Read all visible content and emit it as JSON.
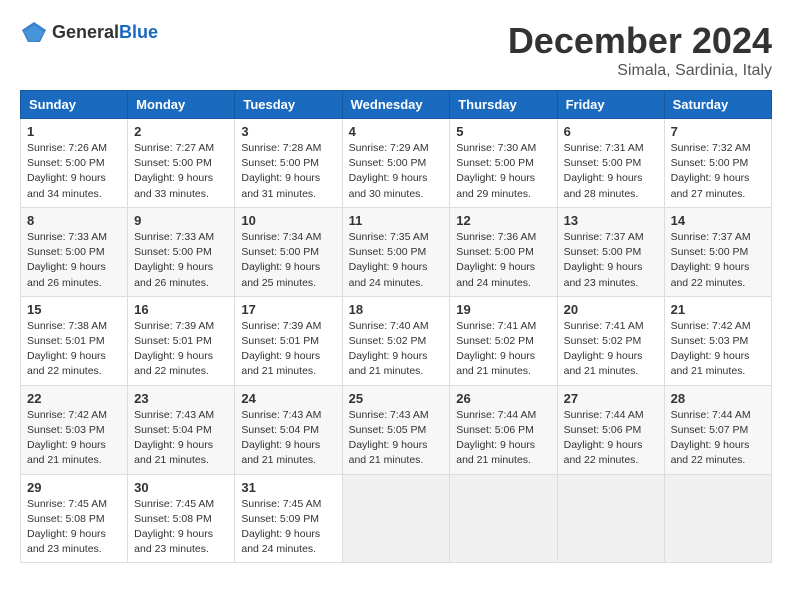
{
  "header": {
    "logo_general": "General",
    "logo_blue": "Blue",
    "month_title": "December 2024",
    "location": "Simala, Sardinia, Italy"
  },
  "weekdays": [
    "Sunday",
    "Monday",
    "Tuesday",
    "Wednesday",
    "Thursday",
    "Friday",
    "Saturday"
  ],
  "weeks": [
    [
      {
        "day": 1,
        "sunrise": "7:26 AM",
        "sunset": "5:00 PM",
        "daylight": "9 hours and 34 minutes."
      },
      {
        "day": 2,
        "sunrise": "7:27 AM",
        "sunset": "5:00 PM",
        "daylight": "9 hours and 33 minutes."
      },
      {
        "day": 3,
        "sunrise": "7:28 AM",
        "sunset": "5:00 PM",
        "daylight": "9 hours and 31 minutes."
      },
      {
        "day": 4,
        "sunrise": "7:29 AM",
        "sunset": "5:00 PM",
        "daylight": "9 hours and 30 minutes."
      },
      {
        "day": 5,
        "sunrise": "7:30 AM",
        "sunset": "5:00 PM",
        "daylight": "9 hours and 29 minutes."
      },
      {
        "day": 6,
        "sunrise": "7:31 AM",
        "sunset": "5:00 PM",
        "daylight": "9 hours and 28 minutes."
      },
      {
        "day": 7,
        "sunrise": "7:32 AM",
        "sunset": "5:00 PM",
        "daylight": "9 hours and 27 minutes."
      }
    ],
    [
      {
        "day": 8,
        "sunrise": "7:33 AM",
        "sunset": "5:00 PM",
        "daylight": "9 hours and 26 minutes."
      },
      {
        "day": 9,
        "sunrise": "7:33 AM",
        "sunset": "5:00 PM",
        "daylight": "9 hours and 26 minutes."
      },
      {
        "day": 10,
        "sunrise": "7:34 AM",
        "sunset": "5:00 PM",
        "daylight": "9 hours and 25 minutes."
      },
      {
        "day": 11,
        "sunrise": "7:35 AM",
        "sunset": "5:00 PM",
        "daylight": "9 hours and 24 minutes."
      },
      {
        "day": 12,
        "sunrise": "7:36 AM",
        "sunset": "5:00 PM",
        "daylight": "9 hours and 24 minutes."
      },
      {
        "day": 13,
        "sunrise": "7:37 AM",
        "sunset": "5:00 PM",
        "daylight": "9 hours and 23 minutes."
      },
      {
        "day": 14,
        "sunrise": "7:37 AM",
        "sunset": "5:00 PM",
        "daylight": "9 hours and 22 minutes."
      }
    ],
    [
      {
        "day": 15,
        "sunrise": "7:38 AM",
        "sunset": "5:01 PM",
        "daylight": "9 hours and 22 minutes."
      },
      {
        "day": 16,
        "sunrise": "7:39 AM",
        "sunset": "5:01 PM",
        "daylight": "9 hours and 22 minutes."
      },
      {
        "day": 17,
        "sunrise": "7:39 AM",
        "sunset": "5:01 PM",
        "daylight": "9 hours and 21 minutes."
      },
      {
        "day": 18,
        "sunrise": "7:40 AM",
        "sunset": "5:02 PM",
        "daylight": "9 hours and 21 minutes."
      },
      {
        "day": 19,
        "sunrise": "7:41 AM",
        "sunset": "5:02 PM",
        "daylight": "9 hours and 21 minutes."
      },
      {
        "day": 20,
        "sunrise": "7:41 AM",
        "sunset": "5:02 PM",
        "daylight": "9 hours and 21 minutes."
      },
      {
        "day": 21,
        "sunrise": "7:42 AM",
        "sunset": "5:03 PM",
        "daylight": "9 hours and 21 minutes."
      }
    ],
    [
      {
        "day": 22,
        "sunrise": "7:42 AM",
        "sunset": "5:03 PM",
        "daylight": "9 hours and 21 minutes."
      },
      {
        "day": 23,
        "sunrise": "7:43 AM",
        "sunset": "5:04 PM",
        "daylight": "9 hours and 21 minutes."
      },
      {
        "day": 24,
        "sunrise": "7:43 AM",
        "sunset": "5:04 PM",
        "daylight": "9 hours and 21 minutes."
      },
      {
        "day": 25,
        "sunrise": "7:43 AM",
        "sunset": "5:05 PM",
        "daylight": "9 hours and 21 minutes."
      },
      {
        "day": 26,
        "sunrise": "7:44 AM",
        "sunset": "5:06 PM",
        "daylight": "9 hours and 21 minutes."
      },
      {
        "day": 27,
        "sunrise": "7:44 AM",
        "sunset": "5:06 PM",
        "daylight": "9 hours and 22 minutes."
      },
      {
        "day": 28,
        "sunrise": "7:44 AM",
        "sunset": "5:07 PM",
        "daylight": "9 hours and 22 minutes."
      }
    ],
    [
      {
        "day": 29,
        "sunrise": "7:45 AM",
        "sunset": "5:08 PM",
        "daylight": "9 hours and 23 minutes."
      },
      {
        "day": 30,
        "sunrise": "7:45 AM",
        "sunset": "5:08 PM",
        "daylight": "9 hours and 23 minutes."
      },
      {
        "day": 31,
        "sunrise": "7:45 AM",
        "sunset": "5:09 PM",
        "daylight": "9 hours and 24 minutes."
      },
      null,
      null,
      null,
      null
    ]
  ]
}
